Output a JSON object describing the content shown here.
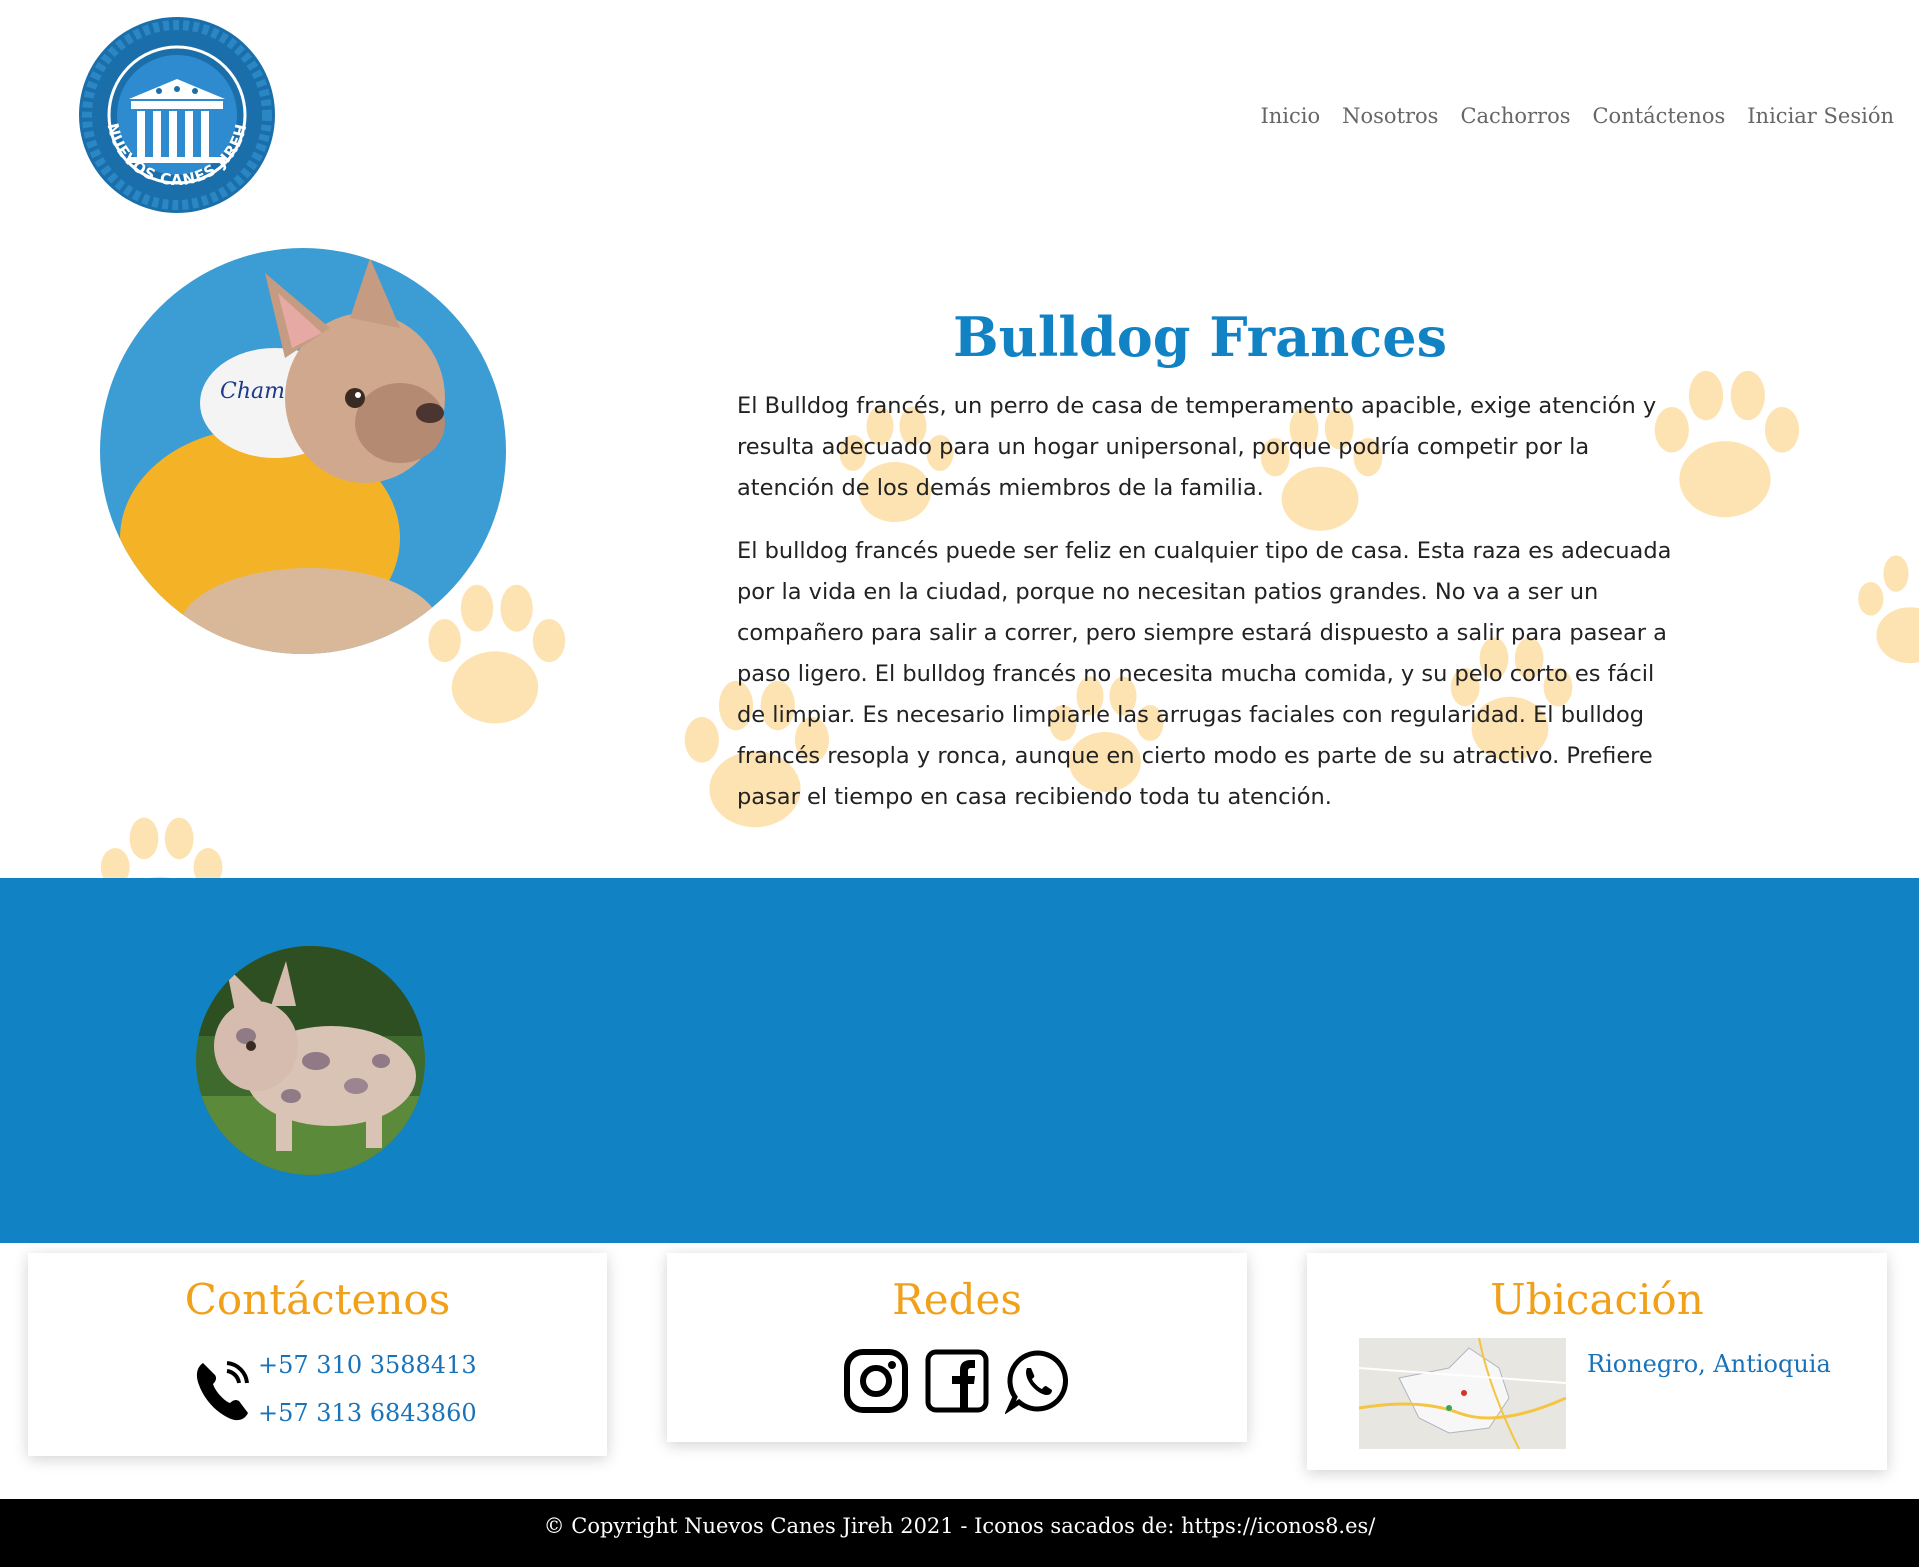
{
  "brand": {
    "logo_text": "NUEVOS CANES JIREH",
    "logo_color": "#1a6fab"
  },
  "nav": {
    "items": [
      {
        "label": "Inicio"
      },
      {
        "label": "Nosotros"
      },
      {
        "label": "Cachorros"
      },
      {
        "label": "Contáctenos"
      },
      {
        "label": "Iniciar Sesión"
      }
    ]
  },
  "hero": {
    "title": "Bulldog Frances",
    "paragraph_1": "El Bulldog francés, un perro de casa de temperamento apacible, exige atención y resulta adecuado para un hogar unipersonal, porque podría competir por la atención de los demás miembros de la familia.",
    "paragraph_2": "El bulldog francés puede ser feliz en cualquier tipo de casa. Esta raza es adecuada por la vida en la ciudad, porque no necesitan patios grandes. No va a ser un compañero para salir a correr, pero siempre estará dispuesto a salir para pasear a paso ligero. El bulldog francés no necesita mucha comida, y su pelo corto es fácil de limpiar. Es necesario limpiarle las arrugas faciales con regularidad. El bulldog francés resopla y ronca, aunque en cierto modo es parte de su atractivo. Prefiere pasar el tiempo en casa recibiendo toda tu atención."
  },
  "colors": {
    "primary_blue": "#1183c5",
    "accent_orange": "#f1a01a",
    "paw": "#fde3b2"
  },
  "contact": {
    "title": "Contáctenos",
    "phones": [
      "+57 310 3588413",
      "+57 313 6843860"
    ]
  },
  "social": {
    "title": "Redes",
    "icons": [
      "instagram-icon",
      "facebook-icon",
      "whatsapp-icon"
    ]
  },
  "location": {
    "title": "Ubicación",
    "place": "Rionegro, Antioquia"
  },
  "footer": {
    "text": "© Copyright Nuevos Canes Jireh 2021 - Iconos sacados de: https://iconos8.es/"
  }
}
